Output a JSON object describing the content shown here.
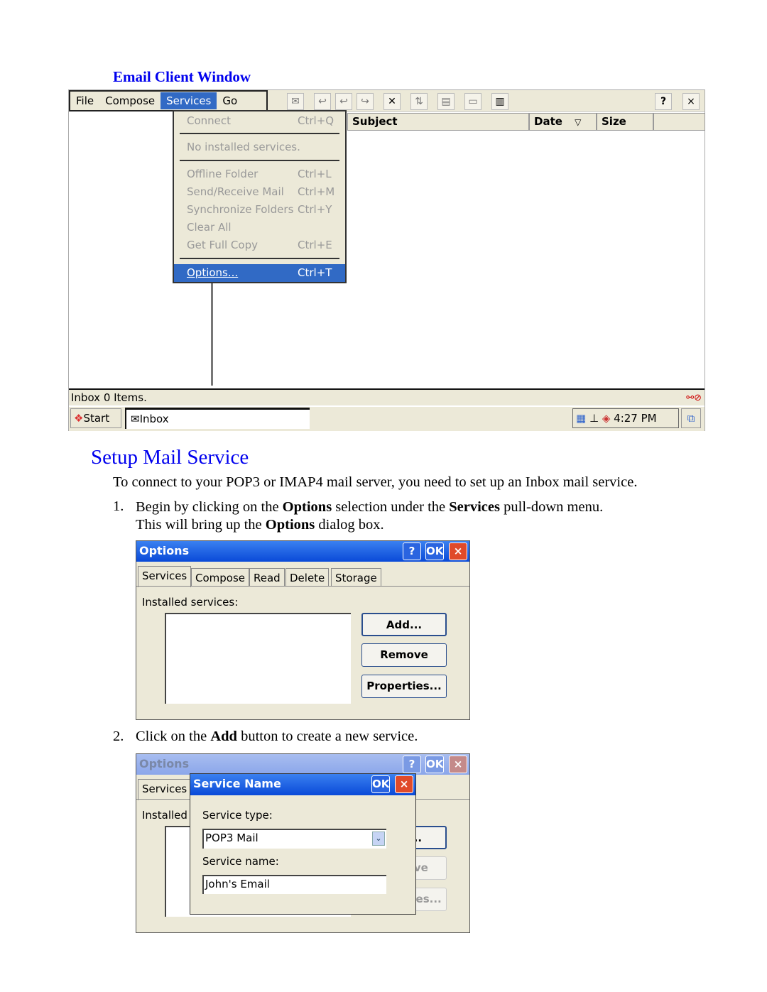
{
  "caption": "Email Client Window",
  "client": {
    "menu": [
      "File",
      "Compose",
      "Services",
      "Go"
    ],
    "active_menu": "Services",
    "toolbar_icons": [
      "new-message-icon",
      "reply-icon",
      "reply-all-icon",
      "forward-icon",
      "delete-icon",
      "send-receive-icon",
      "move-icon",
      "folder-list-icon",
      "address-book-icon"
    ],
    "help": "?",
    "close": "×",
    "columns": [
      "Subject",
      "Date",
      "Size"
    ],
    "date_sort": "▽",
    "dropdown": [
      {
        "label": "Connect",
        "shortcut": "Ctrl+Q",
        "enabled": false
      },
      {
        "label": "No installed services.",
        "shortcut": "",
        "enabled": false
      },
      {
        "label": "Offline Folder",
        "shortcut": "Ctrl+L",
        "enabled": false
      },
      {
        "label": "Send/Receive Mail",
        "shortcut": "Ctrl+M",
        "enabled": false
      },
      {
        "label": "Synchronize Folders",
        "shortcut": "Ctrl+Y",
        "enabled": false
      },
      {
        "label": "Clear All",
        "shortcut": "",
        "enabled": false
      },
      {
        "label": "Get Full Copy",
        "shortcut": "Ctrl+E",
        "enabled": false
      },
      {
        "label": "Options...",
        "shortcut": "Ctrl+T",
        "enabled": true
      }
    ],
    "status": "Inbox 0 Items.",
    "start": "Start",
    "task": "Inbox",
    "time": "4:27 PM"
  },
  "heading": "Setup Mail Service",
  "intro": "To connect to your POP3 or IMAP4 mail server, you need to set up an Inbox mail service.",
  "step1": {
    "num": "1.",
    "a": "Begin by clicking on the ",
    "b": "Options",
    "c": " selection under the ",
    "d": "Services",
    "e": " pull-down menu.",
    "f": "This will bring up the ",
    "g": "Options",
    "h": " dialog box."
  },
  "options": {
    "title": "Options",
    "help": "?",
    "ok": "OK",
    "close": "×",
    "tabs": [
      "Services",
      "Compose",
      "Read",
      "Delete",
      "Storage"
    ],
    "installed": "Installed services:",
    "installed_short": "Installed",
    "buttons": [
      "Add...",
      "Remove",
      "Properties..."
    ]
  },
  "step2": {
    "num": "2.",
    "a": "Click on the ",
    "b": "Add",
    "c": " button to create a new service."
  },
  "service_name": {
    "title": "Service Name",
    "ok": "OK",
    "close": "×",
    "type_label": "Service type:",
    "type_value": "POP3 Mail",
    "name_label": "Service name:",
    "name_value": "John's Email"
  }
}
